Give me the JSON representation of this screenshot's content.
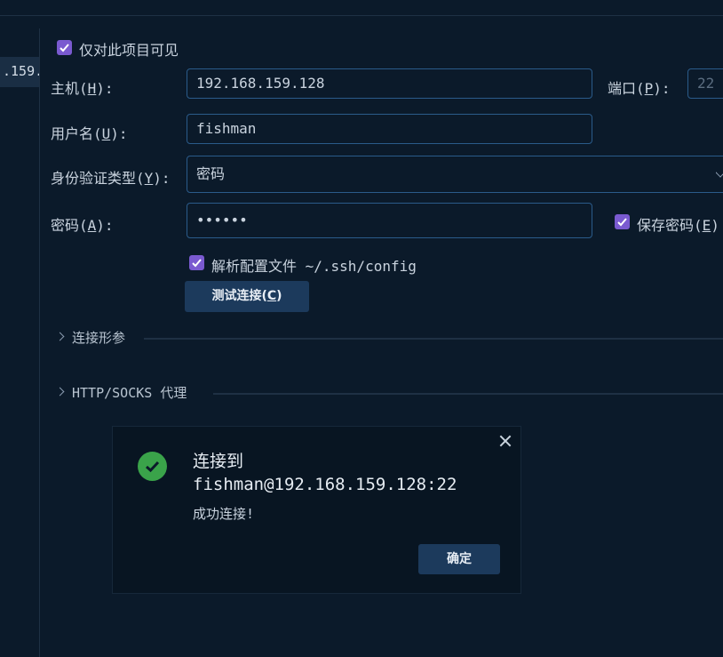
{
  "sidebar": {
    "selected_item": ".159."
  },
  "form": {
    "visible_only_project": {
      "label": "仅对此项目可见",
      "checked": true
    },
    "host": {
      "label_pre": "主机(",
      "label_key": "H",
      "label_post": "):",
      "value": "192.168.159.128"
    },
    "port": {
      "label_pre": "端口(",
      "label_key": "P",
      "label_post": "):",
      "placeholder": "22"
    },
    "username": {
      "label_pre": "用户名(",
      "label_key": "U",
      "label_post": "):",
      "value": "fishman"
    },
    "auth_type": {
      "label_pre": "身份验证类型(",
      "label_key": "Y",
      "label_post": "):",
      "value": "密码"
    },
    "password": {
      "label_pre": "密码(",
      "label_key": "A",
      "label_post": "):",
      "value": "••••••"
    },
    "save_password": {
      "label_pre": "保存密码(",
      "label_key": "E",
      "label_post": ")",
      "checked": true
    },
    "parse_config": {
      "label": "解析配置文件 ~/.ssh/config",
      "checked": true
    },
    "test_button": {
      "label_pre": "测试连接(",
      "label_key": "C",
      "label_post": ")"
    }
  },
  "sections": [
    {
      "title": "连接形参"
    },
    {
      "title": "HTTP/SOCKS 代理"
    }
  ],
  "dialog": {
    "title": "连接到 fishman@192.168.159.128:22",
    "message": "成功连接!",
    "ok_button": "确定"
  },
  "colors": {
    "background": "#0b1a2a",
    "accent_checkbox": "#7a5ad0",
    "success": "#3aa34a",
    "button": "#1c3a5c"
  },
  "icons": [
    "checkbox-checked-icon",
    "chevron-down-icon",
    "chevron-right-icon",
    "success-check-icon",
    "close-icon"
  ]
}
